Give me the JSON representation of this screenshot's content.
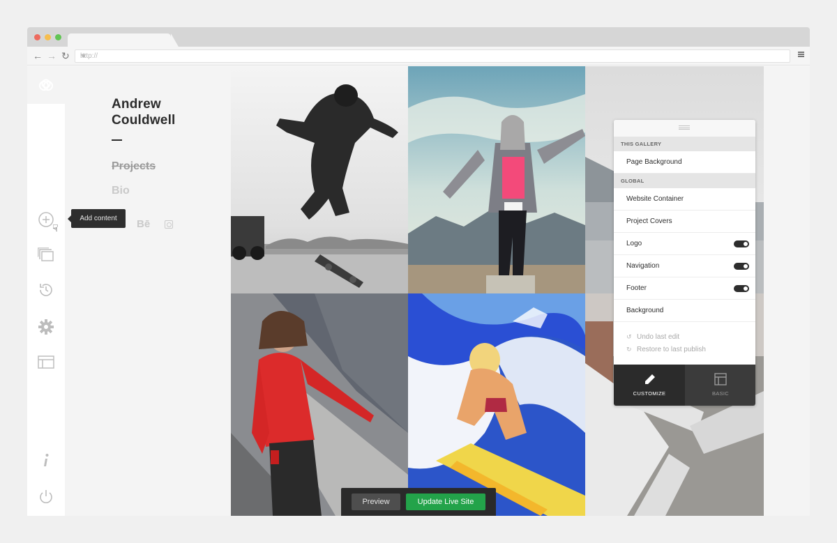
{
  "browser": {
    "url_placeholder": "http://",
    "dots": [
      "#ed6b5f",
      "#f6be4f",
      "#61c554"
    ]
  },
  "rail": {
    "tooltip": "Add content",
    "icons": [
      "creative-cloud-icon",
      "add-icon",
      "collections-icon",
      "history-icon",
      "gear-icon",
      "layout-icon",
      "info-icon",
      "power-icon"
    ]
  },
  "site": {
    "name_line1": "Andrew",
    "name_line2": "Couldwell",
    "nav": [
      "Projects",
      "Bio"
    ],
    "social": [
      "Bē"
    ]
  },
  "panel": {
    "section_gallery": "THIS GALLERY",
    "row_page_background": "Page Background",
    "section_global": "GLOBAL",
    "row_website_container": "Website Container",
    "row_project_covers": "Project Covers",
    "row_logo": "Logo",
    "row_navigation": "Navigation",
    "row_footer": "Footer",
    "row_background": "Background",
    "undo": "Undo last edit",
    "restore": "Restore to last publish",
    "tab_customize": "CUSTOMIZE",
    "tab_basic": "BASIC",
    "toggles": {
      "logo": true,
      "navigation": true,
      "footer": true
    }
  },
  "actions": {
    "preview": "Preview",
    "update": "Update Live Site",
    "update_color": "#23a34a"
  }
}
